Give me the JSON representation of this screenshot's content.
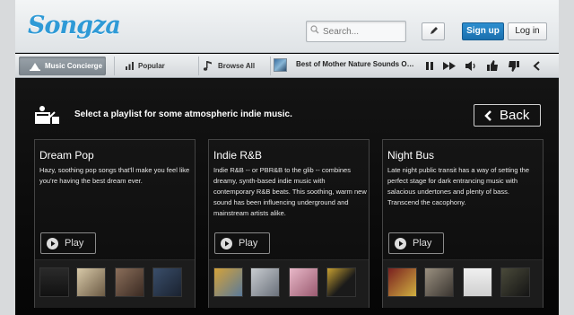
{
  "brand": {
    "logo": "Songza"
  },
  "search": {
    "placeholder": "Search..."
  },
  "header": {
    "signup_label": "Sign up",
    "login_label": "Log in"
  },
  "nav": {
    "tabs": [
      {
        "label": "Music Concierge",
        "icon": "concierge-icon"
      },
      {
        "label": "Popular",
        "icon": "bar-chart-icon"
      },
      {
        "label": "Browse All",
        "icon": "music-note-icon"
      }
    ]
  },
  "player": {
    "now_playing": "Best of Mother Nature Sounds Oce…",
    "controls": [
      "pause-icon",
      "skip-icon",
      "volume-icon",
      "thumbs-up-icon",
      "thumbs-down-icon",
      "share-icon"
    ]
  },
  "concierge": {
    "prompt": "Select a playlist for some atmospheric indie music.",
    "back_label": "Back"
  },
  "playlists": [
    {
      "title": "Dream Pop",
      "description": "Hazy, soothing pop songs that'll make you feel like you're having the best dream ever.",
      "play_label": "Play"
    },
    {
      "title": "Indie R&B",
      "description": "Indie R&B -- or PBR&B to the glib -- combines dreamy, synth-based indie music with contemporary R&B beats. This soothing, warm new sound has been influencing underground and mainstream artists alike.",
      "play_label": "Play"
    },
    {
      "title": "Night Bus",
      "description": "Late night public transit has a way of setting the perfect stage for dark entrancing music with salacious undertones and plenty of bass. Transcend the cacophony.",
      "play_label": "Play"
    }
  ],
  "colors": {
    "brand_blue": "#2f9ad6",
    "signup_blue": "#1f7fc0",
    "background": "#0b0b0b"
  }
}
